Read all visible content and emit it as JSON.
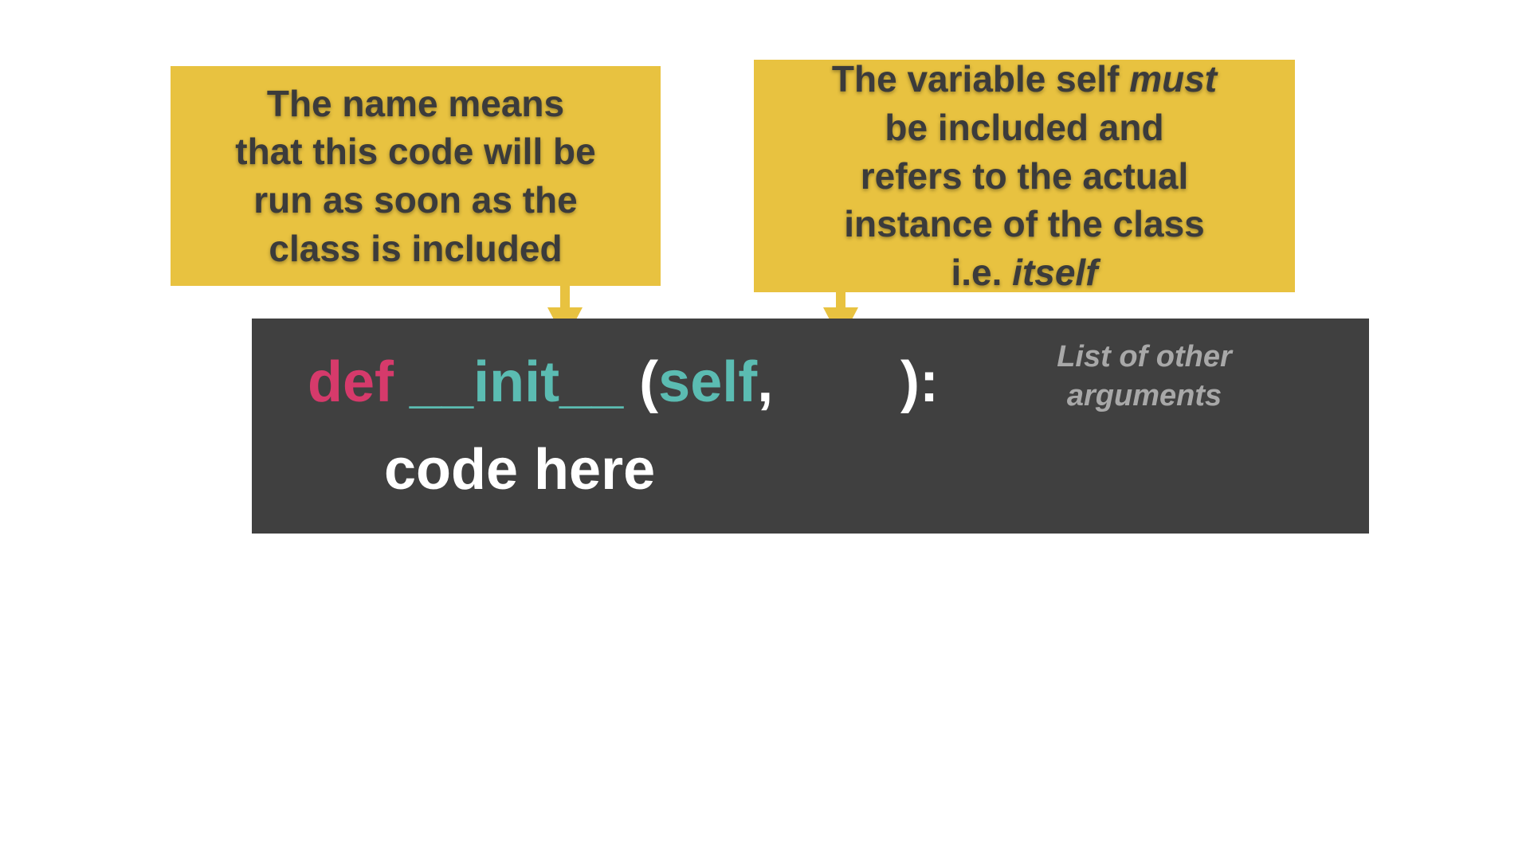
{
  "callouts": {
    "left_lines": [
      "The name means",
      "that this code will be",
      "run as soon as the",
      "class is included"
    ],
    "right": {
      "line1_prefix": "The variable self ",
      "line1_emph": "must",
      "line2": "be included and",
      "line3": "refers to the actual",
      "line4": "instance of the class",
      "line5_prefix": "i.e. ",
      "line5_emph": "itself"
    }
  },
  "code": {
    "keyword_def": "def",
    "func_name": "__init__",
    "open_paren": "(",
    "param_self": "self",
    "comma": ",",
    "close": "):",
    "body": "code here",
    "args_note_line1": "List of other",
    "args_note_line2": "arguments"
  },
  "colors": {
    "callout_bg": "#e8c240",
    "callout_text": "#3b3b3b",
    "code_bg": "#404040",
    "keyword": "#d63a6b",
    "identifier": "#5bbcb2",
    "note": "#a8a8a8"
  }
}
